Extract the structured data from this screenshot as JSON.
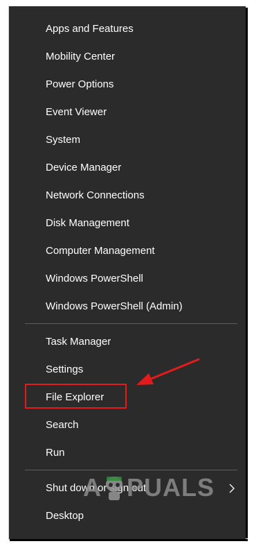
{
  "menu": {
    "group1": [
      {
        "label": "Apps and Features"
      },
      {
        "label": "Mobility Center"
      },
      {
        "label": "Power Options"
      },
      {
        "label": "Event Viewer"
      },
      {
        "label": "System"
      },
      {
        "label": "Device Manager"
      },
      {
        "label": "Network Connections"
      },
      {
        "label": "Disk Management"
      },
      {
        "label": "Computer Management"
      },
      {
        "label": "Windows PowerShell"
      },
      {
        "label": "Windows PowerShell (Admin)"
      }
    ],
    "group2": [
      {
        "label": "Task Manager"
      },
      {
        "label": "Settings"
      },
      {
        "label": "File Explorer"
      },
      {
        "label": "Search"
      },
      {
        "label": "Run"
      }
    ],
    "group3": [
      {
        "label": "Shut down or sign out"
      },
      {
        "label": "Desktop"
      }
    ]
  },
  "annotation": {
    "highlight_color": "#e21c1c",
    "highlighted_item": "File Explorer"
  },
  "watermark": {
    "text_left": "A",
    "text_right": "PUALS"
  },
  "colors": {
    "menu_bg": "#2b2b2b",
    "text": "#ffffff",
    "separator": "#5c5c5c"
  }
}
